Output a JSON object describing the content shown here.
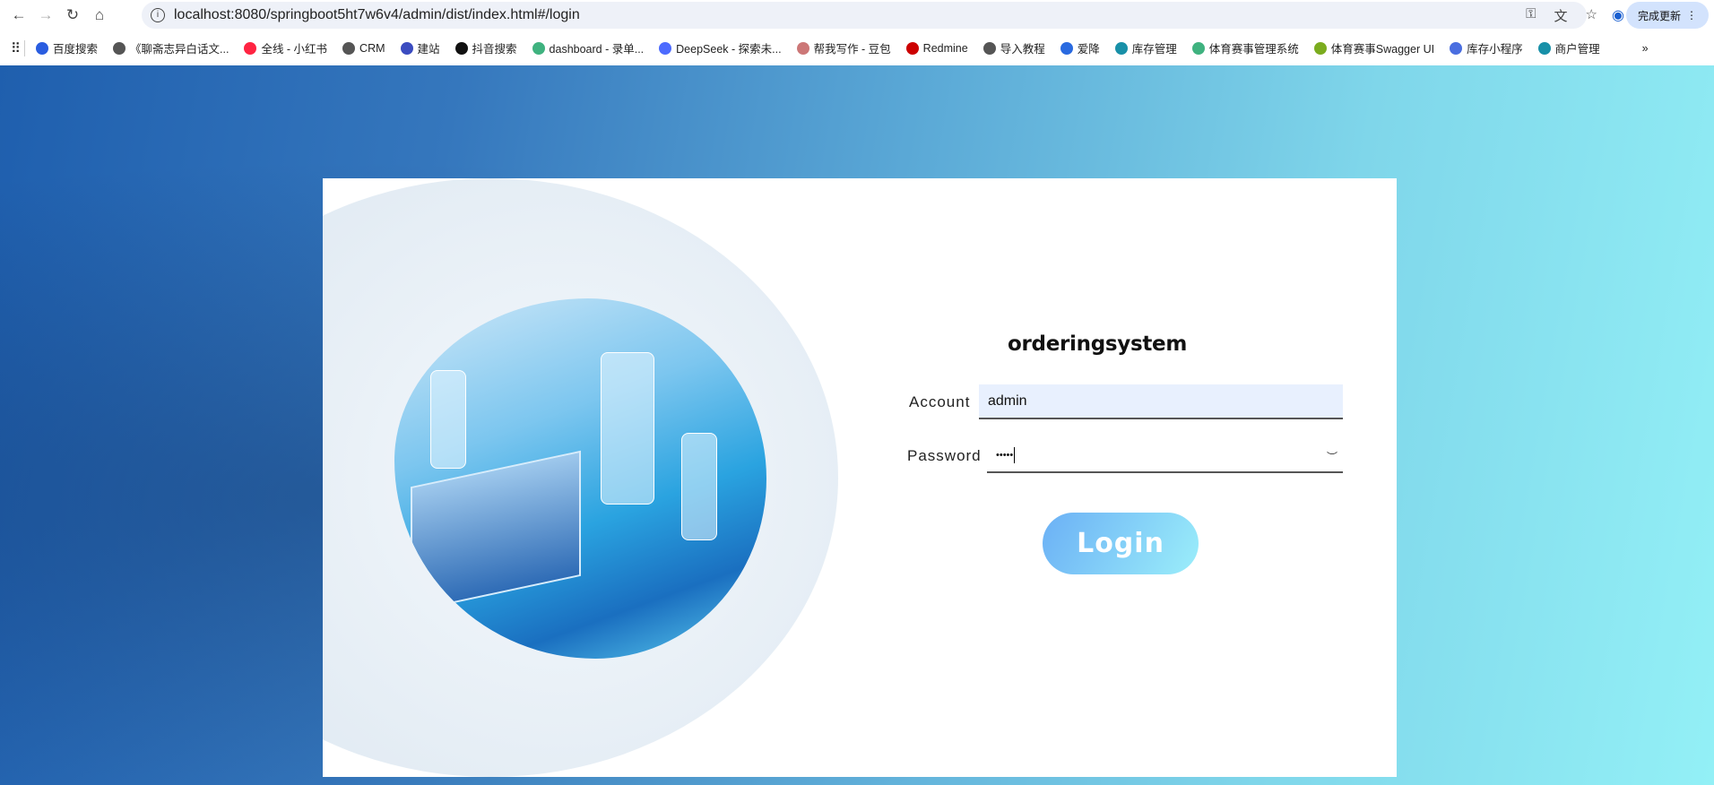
{
  "browser": {
    "url": "localhost:8080/springboot5ht7w6v4/admin/dist/index.html#/login",
    "update_label": "完成更新",
    "bookmarks": [
      "百度搜索",
      "《聊斋志异白话文...",
      "全线 - 小红书",
      "CRM",
      "建站",
      "抖音搜索",
      "dashboard - 录单...",
      "DeepSeek - 探索未...",
      "帮我写作 - 豆包",
      "Redmine",
      "导入教程",
      "爱降",
      "库存管理",
      "体育赛事管理系统",
      "体育赛事Swagger UI",
      "库存小程序",
      "商户管理"
    ],
    "bookmark_colors": [
      "#2a5de0",
      "#555",
      "#ff2442",
      "#555",
      "#3b4cc0",
      "#111",
      "#3fb27f",
      "#4d6bfe",
      "#c77",
      "#c00",
      "#555",
      "#2a6ae0",
      "#1890a8",
      "#3fb27f",
      "#7bac1f",
      "#4a6ee0",
      "#1890a8"
    ],
    "overflow": "»"
  },
  "login": {
    "title": "orderingsystem",
    "account_label": "Account",
    "account_value": "admin",
    "password_label": "Password",
    "password_value": "•••••",
    "button": "Login"
  }
}
